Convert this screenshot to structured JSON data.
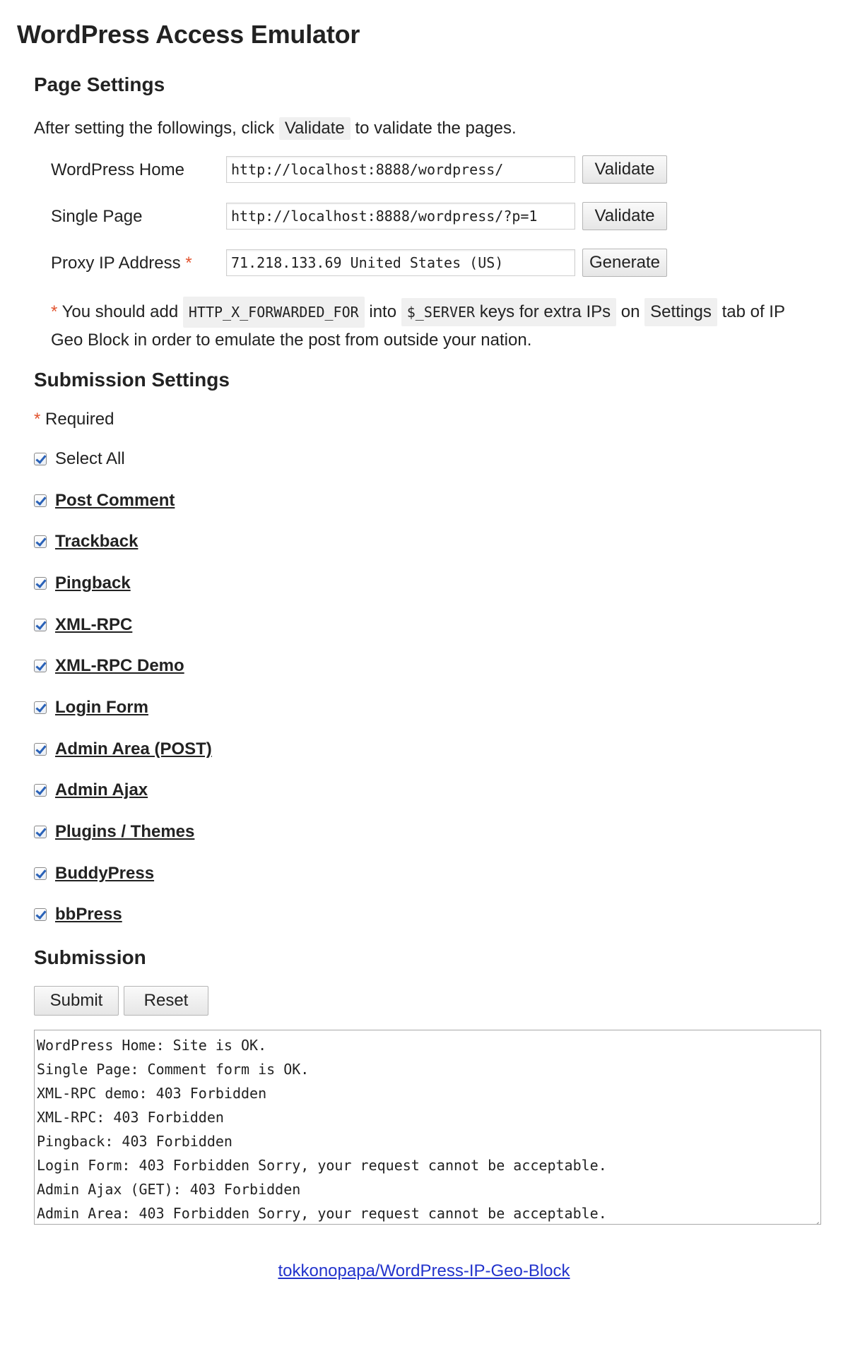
{
  "page": {
    "title": "WordPress Access Emulator"
  },
  "page_settings": {
    "heading": "Page Settings",
    "intro_before": "After setting the followings, click",
    "intro_chip": "Validate",
    "intro_after": "to validate the pages.",
    "rows": [
      {
        "label": "WordPress Home",
        "value": "http://localhost:8888/wordpress/",
        "button": "Validate"
      },
      {
        "label": "Single Page",
        "value": "http://localhost:8888/wordpress/?p=1",
        "button": "Validate"
      },
      {
        "label": "Proxy IP Address",
        "required_mark": "*",
        "value": "71.218.133.69 United States (US)",
        "button": "Generate"
      }
    ],
    "note": {
      "star": "*",
      "part1": "You should add",
      "chip1": "HTTP_X_FORWARDED_FOR",
      "part2": "into",
      "chip2a": "$_SERVER",
      "chip2b": "keys for extra IPs",
      "part3": "on",
      "chip3": "Settings",
      "part4": "tab of IP Geo Block in order to emulate the post from outside your nation."
    }
  },
  "submission_settings": {
    "heading": "Submission Settings",
    "required_star": "*",
    "required_text": "Required",
    "select_all": {
      "label": "Select All",
      "checked": true
    },
    "items": [
      {
        "label": "Post Comment",
        "checked": true
      },
      {
        "label": "Trackback",
        "checked": true
      },
      {
        "label": "Pingback",
        "checked": true
      },
      {
        "label": "XML-RPC",
        "checked": true
      },
      {
        "label": "XML-RPC Demo",
        "checked": true
      },
      {
        "label": "Login Form",
        "checked": true
      },
      {
        "label": "Admin Area (POST)",
        "checked": true
      },
      {
        "label": "Admin Ajax",
        "checked": true
      },
      {
        "label": "Plugins / Themes",
        "checked": true
      },
      {
        "label": "BuddyPress",
        "checked": true
      },
      {
        "label": "bbPress",
        "checked": true
      }
    ]
  },
  "submission": {
    "heading": "Submission",
    "submit_label": "Submit",
    "reset_label": "Reset",
    "output_lines": [
      "WordPress Home: Site is OK.",
      "Single Page: Comment form is OK.",
      "XML-RPC demo: 403 Forbidden",
      "XML-RPC: 403 Forbidden",
      "Pingback: 403 Forbidden",
      "Login Form: 403 Forbidden Sorry, your request cannot be acceptable.",
      "Admin Ajax (GET): 403 Forbidden",
      "Admin Area: 403 Forbidden Sorry, your request cannot be acceptable."
    ]
  },
  "footer": {
    "link_text": "tokkonopapa/WordPress-IP-Geo-Block"
  }
}
